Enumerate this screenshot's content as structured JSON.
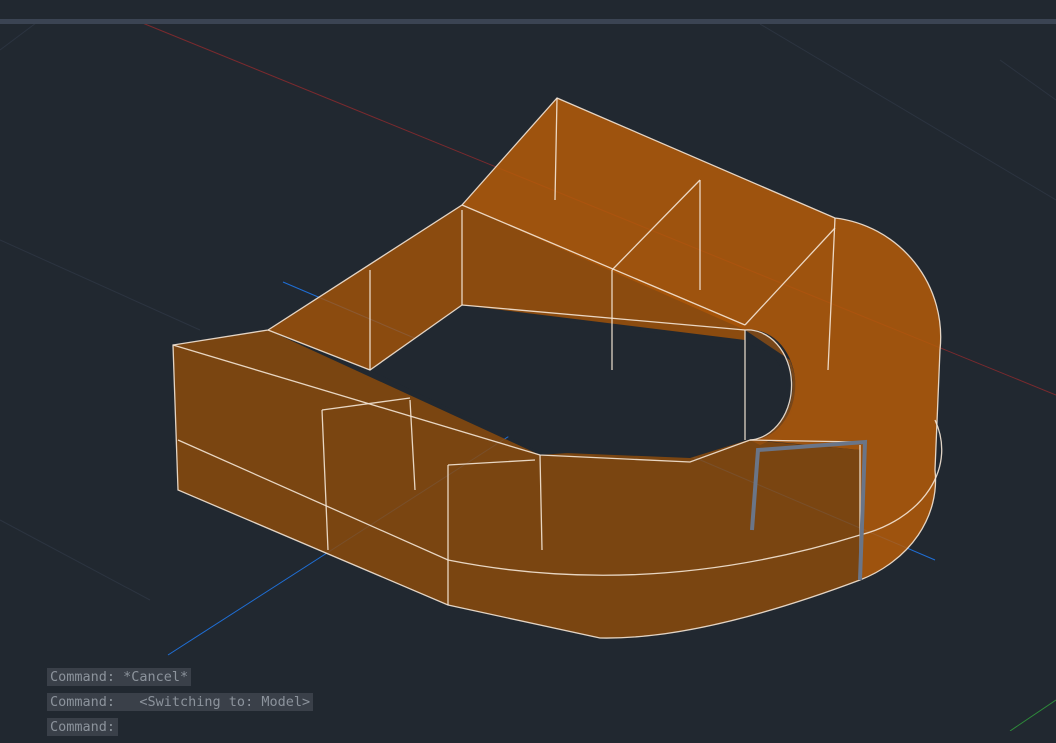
{
  "command_history": [
    "Command: *Cancel*",
    "Command:   <Switching to: Model>",
    "Command:"
  ],
  "colors": {
    "background": "#212830",
    "solid": "#c8660a",
    "x_axis": "#8a2a2a",
    "y_axis": "#1f6fd6",
    "edge": "#f4e6d6"
  }
}
